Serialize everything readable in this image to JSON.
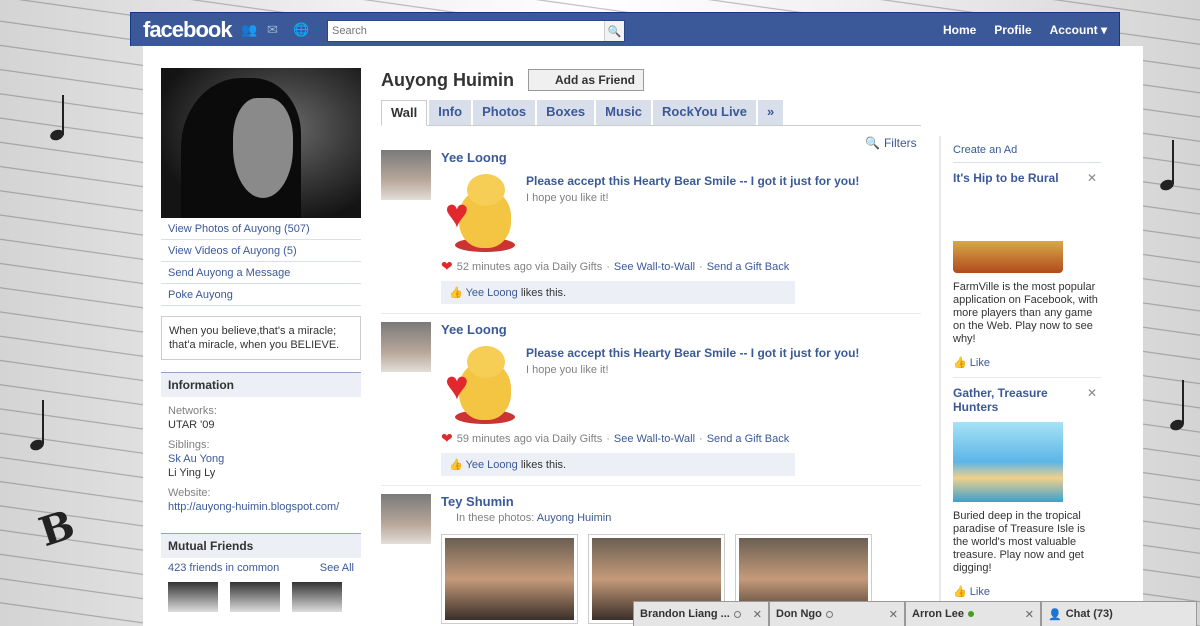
{
  "brand": "facebook",
  "search": {
    "placeholder": "Search"
  },
  "topnav": [
    "Home",
    "Profile",
    "Account ▾"
  ],
  "profile": {
    "name": "Auyong Huimin",
    "add_friend": "Add as Friend",
    "links": [
      "View Photos of Auyong (507)",
      "View Videos of Auyong (5)",
      "Send Auyong a Message",
      "Poke Auyong"
    ],
    "quote": "When you believe,that's a miracle; that'a miracle, when you BELIEVE."
  },
  "information": {
    "heading": "Information",
    "networks_label": "Networks:",
    "networks": "UTAR '09",
    "siblings_label": "Siblings:",
    "sibling1": "Sk Au Yong",
    "sibling2": "Li Ying Ly",
    "website_label": "Website:",
    "website": "http://auyong-huimin.blogspot.com/"
  },
  "mutual": {
    "heading": "Mutual Friends",
    "count": "423 friends in common",
    "see_all": "See All"
  },
  "tabs": [
    "Wall",
    "Info",
    "Photos",
    "Boxes",
    "Music",
    "RockYou Live",
    "»"
  ],
  "filters": "Filters",
  "stories": [
    {
      "actor": "Yee Loong",
      "title": "Please accept this Hearty Bear Smile -- I got it just for you!",
      "sub": "I hope you like it!",
      "time": "52 minutes ago via Daily Gifts",
      "link1": "See Wall-to-Wall",
      "link2": "Send a Gift Back",
      "liker": "Yee Loong",
      "likes_text": "likes this."
    },
    {
      "actor": "Yee Loong",
      "title": "Please accept this Hearty Bear Smile -- I got it just for you!",
      "sub": "I hope you like it!",
      "time": "59 minutes ago via Daily Gifts",
      "link1": "See Wall-to-Wall",
      "link2": "Send a Gift Back",
      "liker": "Yee Loong",
      "likes_text": "likes this."
    }
  ],
  "story3": {
    "actor": "Tey Shumin",
    "in_photos": "In these photos:",
    "tagged": "Auyong Huimin"
  },
  "ads": {
    "create": "Create an Ad",
    "ad1": {
      "title": "It's Hip to be Rural",
      "text": "FarmVille is the most popular application on Facebook, with more players than any game on the Web. Play now to see why!",
      "like": "Like"
    },
    "ad2": {
      "title": "Gather, Treasure Hunters",
      "text": "Buried deep in the tropical paradise of Treasure Isle is the world's most valuable treasure. Play now and get digging!",
      "like": "Like"
    }
  },
  "chat": {
    "c1": "Brandon Liang ...",
    "c2": "Don Ngo",
    "c3": "Arron Lee",
    "c4": "Chat (73)"
  },
  "colors": {
    "brand": "#3b5998",
    "link": "#3b5998",
    "online": "#3fa11e"
  }
}
